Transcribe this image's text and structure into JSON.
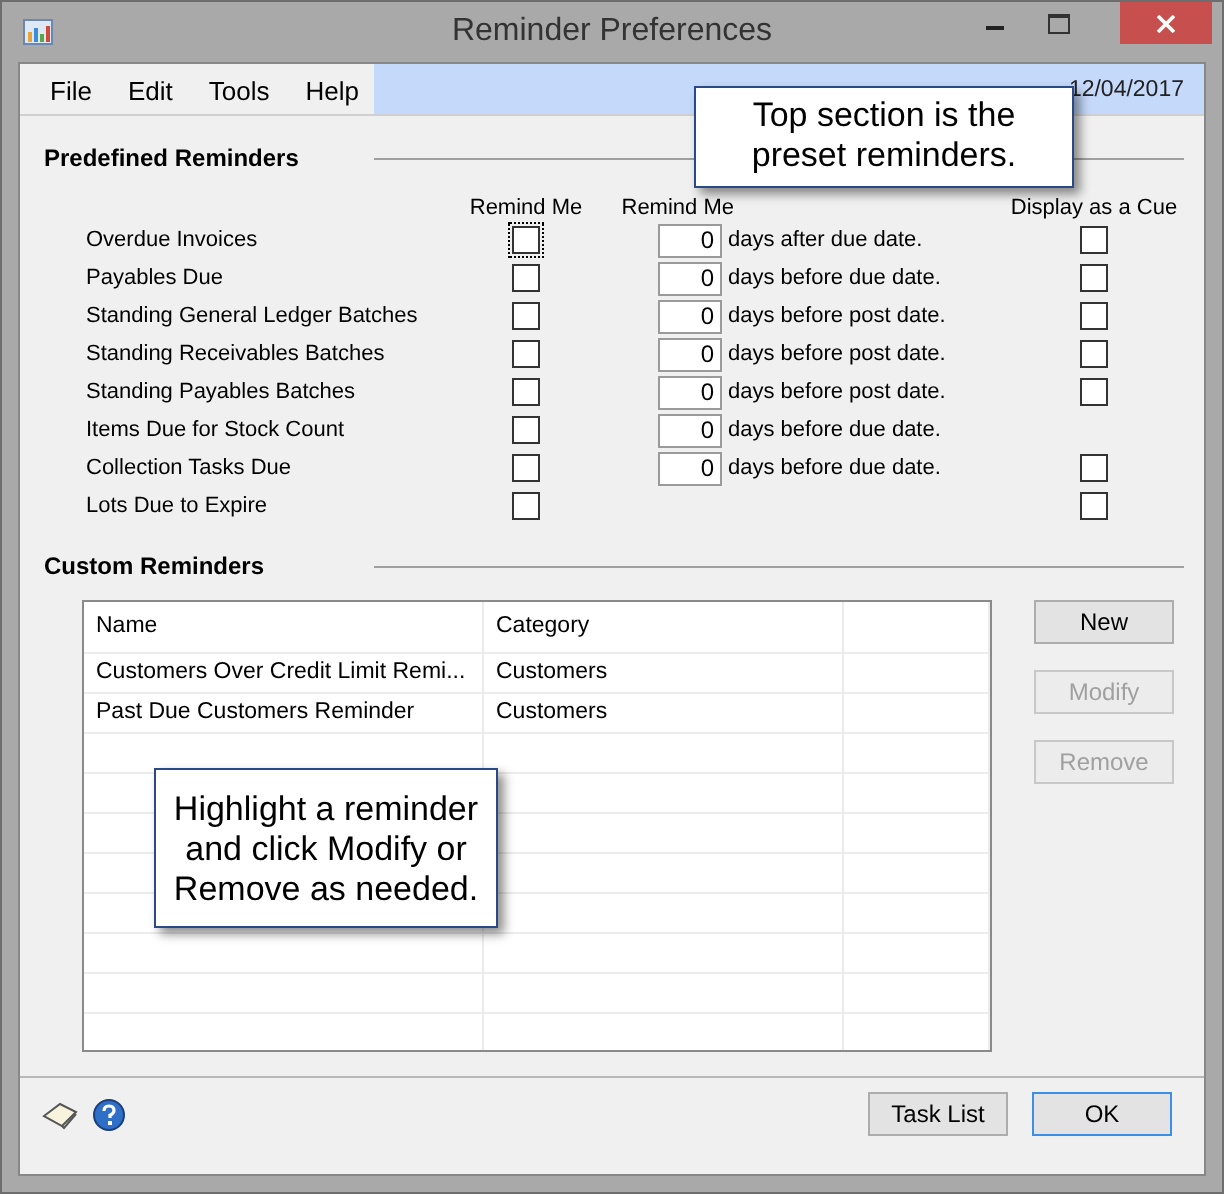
{
  "window": {
    "title": "Reminder Preferences"
  },
  "menu": [
    "File",
    "Edit",
    "Tools",
    "Help"
  ],
  "menu_status": "12/04/2017",
  "predefined": {
    "heading": "Predefined Reminders",
    "columns": [
      "Remind Me",
      "Remind Me",
      "Display as a Cue"
    ],
    "rows": [
      {
        "label": "Overdue Invoices",
        "remind": false,
        "focused": true,
        "days": "0",
        "days_text": "days after due date.",
        "cue": false
      },
      {
        "label": "Payables Due",
        "remind": false,
        "focused": false,
        "days": "0",
        "days_text": "days before due date.",
        "cue": false
      },
      {
        "label": "Standing General Ledger Batches",
        "remind": false,
        "focused": false,
        "days": "0",
        "days_text": "days before post date.",
        "cue": false
      },
      {
        "label": "Standing Receivables Batches",
        "remind": false,
        "focused": false,
        "days": "0",
        "days_text": "days before post date.",
        "cue": false
      },
      {
        "label": "Standing Payables Batches",
        "remind": false,
        "focused": false,
        "days": "0",
        "days_text": "days before post date.",
        "cue": false
      },
      {
        "label": "Items Due for Stock Count",
        "remind": false,
        "focused": false,
        "days": "0",
        "days_text": "days before due date."
      },
      {
        "label": "Collection Tasks Due",
        "remind": false,
        "focused": false,
        "days": "0",
        "days_text": "days before due date.",
        "cue": false
      },
      {
        "label": "Lots Due to Expire",
        "remind": false,
        "focused": false,
        "cue": false
      }
    ]
  },
  "custom": {
    "heading": "Custom Reminders",
    "table": {
      "columns": [
        "Name",
        "Category"
      ],
      "rows": [
        {
          "name": "Customers Over Credit Limit Remi...",
          "category": "Customers"
        },
        {
          "name": "Past Due Customers Reminder",
          "category": "Customers"
        }
      ]
    },
    "buttons": [
      {
        "label": "New",
        "disabled": false
      },
      {
        "label": "Modify",
        "disabled": true
      },
      {
        "label": "Remove",
        "disabled": true
      }
    ]
  },
  "footer_buttons": [
    {
      "label": "Task List",
      "focused": false
    },
    {
      "label": "OK",
      "focused": true
    }
  ],
  "callouts": [
    "Top section is the preset reminders.",
    "Highlight a reminder and click Modify or Remove as needed."
  ]
}
